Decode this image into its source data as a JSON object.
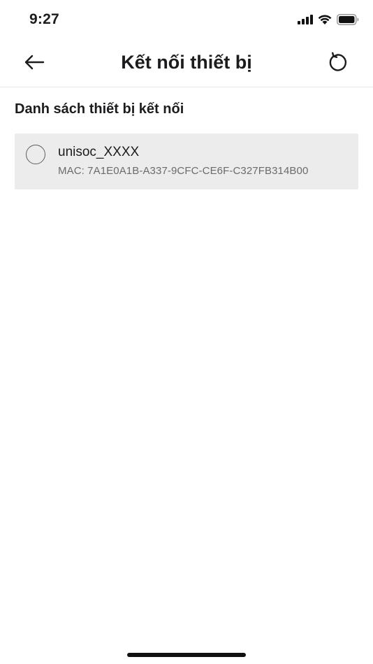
{
  "status_bar": {
    "time": "9:27",
    "icons": [
      "cellular-signal-icon",
      "wifi-icon",
      "battery-icon"
    ]
  },
  "header": {
    "title": "Kết nối thiết bị",
    "back_icon": "arrow-left-icon",
    "refresh_icon": "refresh-icon"
  },
  "section": {
    "title": "Danh sách thiết bị kết nối"
  },
  "devices": [
    {
      "name": "unisoc_XXXX",
      "mac": "MAC: 7A1E0A1B-A337-9CFC-CE6F-C327FB314B00",
      "selected": false
    }
  ],
  "colors": {
    "background": "#ffffff",
    "item_background": "#ececec",
    "primary_text": "#1c1c1e",
    "secondary_text": "#6b6b6b",
    "divider": "#e6e6e6"
  }
}
